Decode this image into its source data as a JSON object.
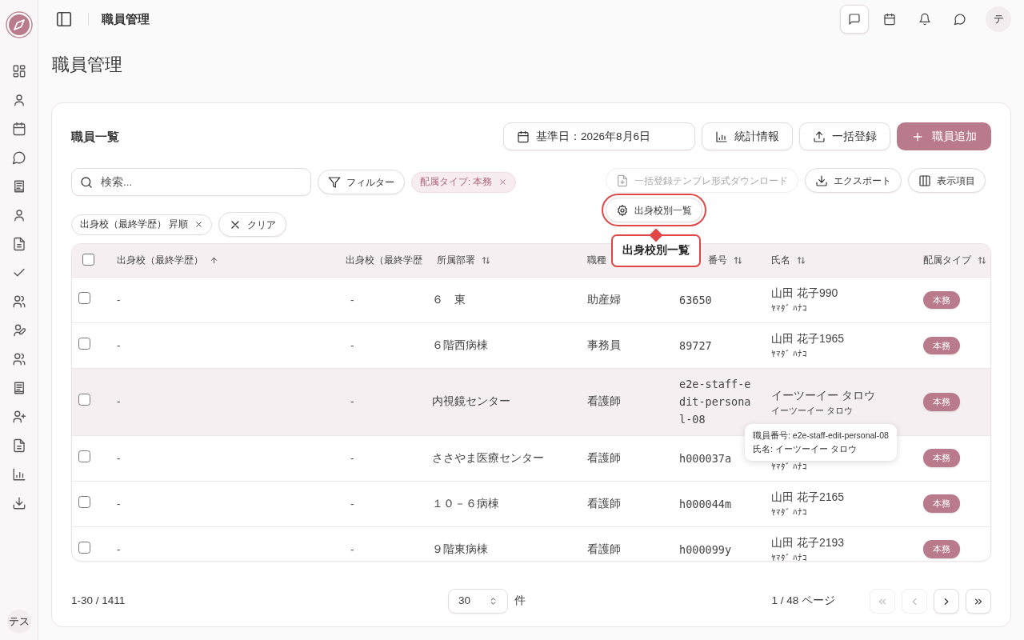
{
  "topbar": {
    "title": "職員管理",
    "avatar": "テ"
  },
  "sidebar": {
    "avatar": "テス"
  },
  "page_title": "職員管理",
  "card": {
    "title": "職員一覧",
    "date_button": "基準日：2026年8月6日",
    "stats_button": "統計情報",
    "bulk_button": "一括登録",
    "add_button": "職員追加"
  },
  "search": {
    "placeholder": "検索..."
  },
  "filter_button": "フィルター",
  "chips": [
    {
      "label": "配属タイプ: 本務",
      "kind": "accent"
    },
    {
      "label": "出身校（最終学歴） 昇順",
      "kind": "plain"
    }
  ],
  "clear_button": "クリア",
  "template_button": {
    "label": "一括登録テンプレ形式ダウンロード",
    "disabled": true
  },
  "export_button": "エクスポート",
  "columns_button": "表示項目",
  "school_button": {
    "label": "出身校別一覧",
    "highlighted": true
  },
  "school_tooltip": "出身校別一覧",
  "table": {
    "select_all": {
      "checked": false
    },
    "columns": [
      {
        "label": "出身校（最終学歴）",
        "kind": "ascending"
      },
      {
        "label": "出身校（最終学歴",
        "kind": "plain"
      },
      {
        "label": "所属部署",
        "kind": "sortable"
      },
      {
        "label": "職種",
        "kind": "plain"
      },
      {
        "label": "番号",
        "kind": "sortable"
      },
      {
        "label": "氏名",
        "kind": "sortable"
      },
      {
        "label": "配属タイプ",
        "kind": "sortable"
      }
    ],
    "rows": [
      {
        "checked": false,
        "hovered": false,
        "school": "-",
        "school_2": "-",
        "dept": "６　東",
        "job": "助産婦",
        "number": "63650",
        "name": "山田 花子990",
        "kana": "ﾔﾏﾀﾞ ﾊﾅｺ",
        "type": "本務"
      },
      {
        "checked": false,
        "hovered": false,
        "school": "-",
        "school_2": "-",
        "dept": "６階西病棟",
        "job": "事務員",
        "number": "89727",
        "name": "山田 花子1965",
        "kana": "ﾔﾏﾀﾞ ﾊﾅｺ",
        "type": "本務"
      },
      {
        "checked": false,
        "hovered": true,
        "school": "-",
        "school_2": "-",
        "dept": "内視鏡センター",
        "job": "看護師",
        "number": "e2e-staff-edit-personal-08",
        "name": "イーツーイー タロウ",
        "kana": "イーツーイー タロウ",
        "type": "本務"
      },
      {
        "checked": false,
        "hovered": false,
        "school": "-",
        "school_2": "-",
        "dept": "ささやま医療センター",
        "job": "看護師",
        "number": "h000037a",
        "kana": "ﾔﾏﾀﾞ ﾊﾅｺ",
        "type": "本務"
      },
      {
        "checked": false,
        "hovered": false,
        "school": "-",
        "school_2": "-",
        "dept": "１０－６病棟",
        "job": "看護師",
        "number": "h000044m",
        "name": "山田 花子2165",
        "kana": "ﾔﾏﾀﾞ ﾊﾅｺ",
        "type": "本務"
      },
      {
        "checked": false,
        "hovered": false,
        "school": "-",
        "school_2": "-",
        "dept": "９階東病棟",
        "job": "看護師",
        "number": "h000099y",
        "name": "山田 花子2193",
        "kana": "ﾔﾏﾀﾞ ﾊﾅｺ",
        "type": "本務"
      }
    ]
  },
  "hover_tooltip": [
    "職員番号: e2e-staff-edit-personal-08",
    "氏名: イーツーイー タロウ"
  ],
  "pagination": {
    "range": "1-30 / 1411",
    "page_size": "30",
    "unit": "件",
    "page": "1 / 48 ページ",
    "first_disabled": true,
    "prev_disabled": true,
    "next_disabled": false,
    "last_disabled": false
  }
}
